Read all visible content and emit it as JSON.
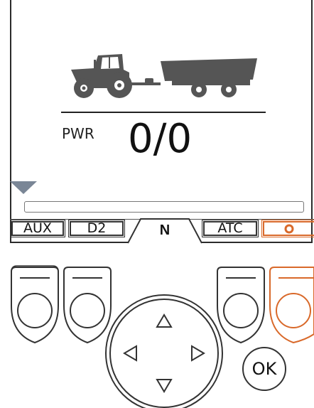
{
  "display": {
    "power_label": "PWR",
    "power_value": "0/0"
  },
  "tabs": [
    {
      "label": "AUX"
    },
    {
      "label": "D2"
    },
    {
      "label": "N"
    },
    {
      "label": "ATC"
    },
    {
      "label": "",
      "icon": "gear-icon"
    }
  ],
  "hardware": {
    "ok_label": "OK",
    "dpad": [
      "up",
      "left",
      "right",
      "down"
    ]
  },
  "colors": {
    "accent": "#d9692a",
    "vehicle": "#555555",
    "marker": "#7a8696"
  }
}
